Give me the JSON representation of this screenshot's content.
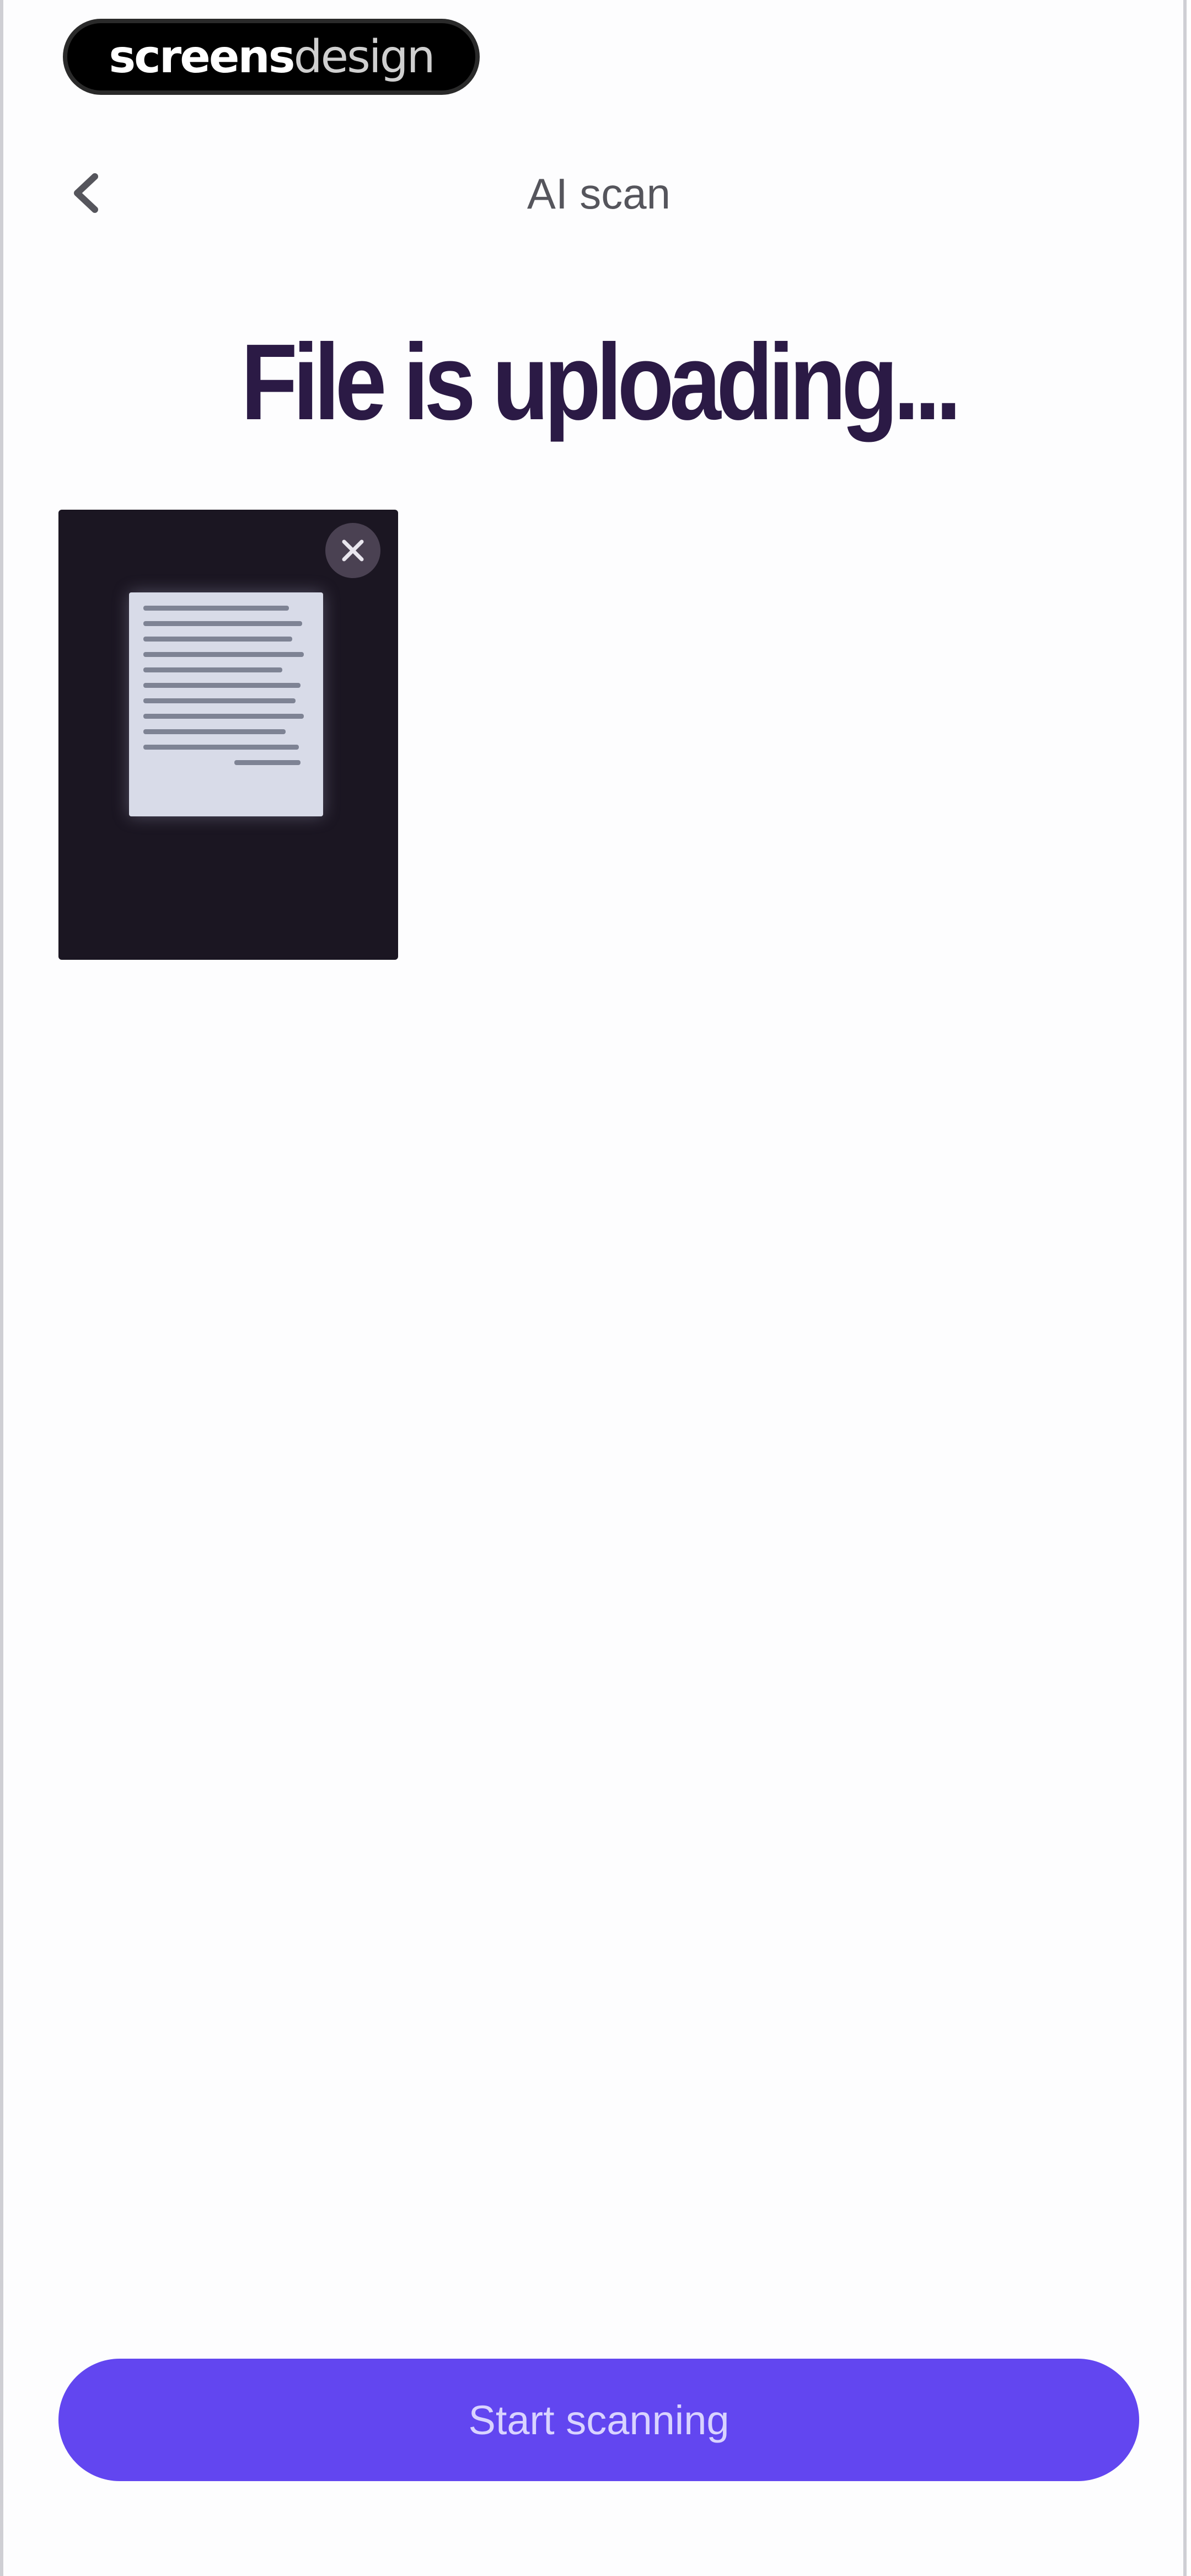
{
  "watermark": {
    "bold_text": "screens",
    "light_text": "design"
  },
  "header": {
    "title": "AI scan",
    "back_icon": "chevron-left-icon"
  },
  "main": {
    "heading": "File is uploading...",
    "upload": {
      "remove_icon": "close-icon"
    }
  },
  "footer": {
    "primary_button_label": "Start scanning"
  },
  "colors": {
    "accent": "#6246f0",
    "heading": "#2b1a45",
    "thumbnail_bg": "#1b1622"
  }
}
